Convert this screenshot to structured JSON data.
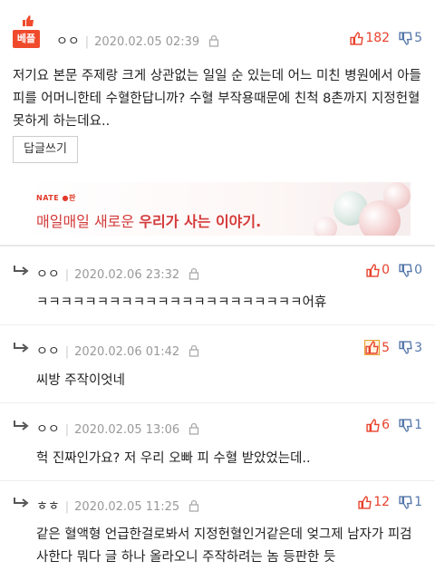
{
  "best_comment": {
    "badge_label": "베플",
    "author": "ㅇㅇ",
    "datetime": "2020.02.05 02:39",
    "upvotes": "182",
    "downvotes": "5",
    "text": "저기요 본문 주제랑 크게 상관없는 일일 순 있는데 어느 미친 병원에서 아들 피를 어머니한테 수혈한답니까? 수혈 부작용때문에 친척 8촌까지 지정헌혈 못하게 하는데요..",
    "reply_button": "답글쓰기"
  },
  "ad": {
    "brand": "NATE ●판",
    "slogan_plain": "매일매일 새로운 ",
    "slogan_bold": "우리가 사는 이야기."
  },
  "replies": [
    {
      "author": "ㅇㅇ",
      "datetime": "2020.02.06 23:32",
      "upvotes": "0",
      "downvotes": "0",
      "text": "ㅋㅋㅋㅋㅋㅋㅋㅋㅋㅋㅋㅋㅋㅋㅋㅋㅋㅋㅋㅋㅋㅋ어휴"
    },
    {
      "author": "ㅇㅇ",
      "datetime": "2020.02.06 01:42",
      "upvotes": "5",
      "downvotes": "3",
      "text": "씨방 주작이엇네"
    },
    {
      "author": "ㅇㅇ",
      "datetime": "2020.02.05 13:06",
      "upvotes": "6",
      "downvotes": "1",
      "text": "헉 진짜인가요? 저 우리 오빠 피 수혈 받았었는데.."
    },
    {
      "author": "ㅎㅎ",
      "datetime": "2020.02.05 11:25",
      "upvotes": "12",
      "downvotes": "1",
      "text": "같은 혈액형 언급한걸로봐서 지정헌혈인거같은데 엊그제 남자가 피검사한다 뭐다 글 하나 올라오니 주작하려는 놈 등판한 듯"
    }
  ],
  "colors": {
    "accent": "#f04a2c",
    "up": "#e8412b",
    "down": "#5577aa",
    "meta": "#999999"
  },
  "icons": {
    "upvote": "thumb-up-icon",
    "downvote": "thumb-down-icon",
    "lock": "lock-icon",
    "reply_arrow": "reply-arrow-icon"
  }
}
